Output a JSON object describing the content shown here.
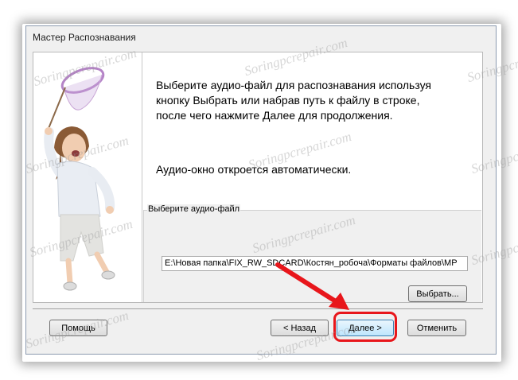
{
  "window": {
    "title": "Мастер Распознавания"
  },
  "instructions": {
    "line1": "Выберите аудио-файл для распознавания используя",
    "line2": "кнопку Выбрать или набрав путь к файлу в строке,",
    "line3": "после чего нажмите Далее для продолжения.",
    "auto_note": "Аудио-окно откроется автоматически."
  },
  "file_group": {
    "label": "Выберите аудио-файл",
    "path_value": "E:\\Новая папка\\FIX_RW_SDCARD\\Костян_робоча\\Форматы файлов\\МР",
    "browse_label": "Выбрать..."
  },
  "buttons": {
    "help": "Помощь",
    "back": "< Назад",
    "next": "Далее >",
    "cancel": "Отменить"
  },
  "watermark": "Soringpcrepair.com",
  "colors": {
    "annotation": "#e8161b",
    "net_purple": "#b584c7"
  },
  "icons": [
    "girl-with-net-illustration",
    "red-arrow-annotation"
  ]
}
